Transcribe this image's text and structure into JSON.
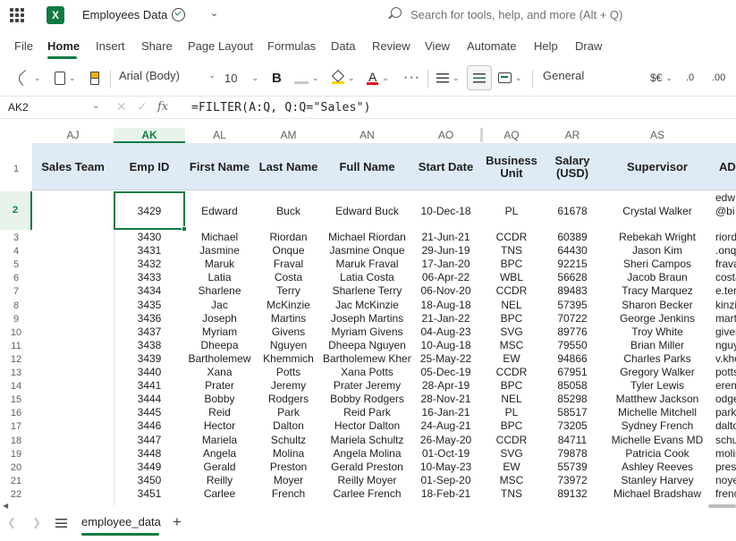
{
  "app": {
    "title": "Employees Data",
    "search_placeholder": "Search for tools, help, and more (Alt + Q)"
  },
  "ribbon": {
    "tabs": [
      "File",
      "Home",
      "Insert",
      "Share",
      "Page Layout",
      "Formulas",
      "Data",
      "Review",
      "View",
      "Automate",
      "Help",
      "Draw"
    ],
    "active_tab": "Home",
    "font_name": "Arial (Body)",
    "font_size": "10",
    "bold_label": "B",
    "font_color_label": "A",
    "number_format": "General",
    "currency_label": "$€",
    "increase_decimal_label": ".0",
    "decrease_decimal_label": ".00"
  },
  "formula_bar": {
    "name_box": "AK2",
    "fx_label": "fx",
    "formula": "=FILTER(A:Q, Q:Q=\"Sales\")"
  },
  "grid": {
    "column_headers": [
      "AJ",
      "AK",
      "AL",
      "AM",
      "AN",
      "AO",
      "AQ",
      "AR",
      "AS"
    ],
    "active_column": "AK",
    "row_numbers": [
      "1",
      "2",
      "3",
      "4",
      "5",
      "6",
      "7",
      "8",
      "9",
      "10",
      "11",
      "12",
      "13",
      "14",
      "15",
      "16",
      "17",
      "18",
      "19",
      "20",
      "21",
      "22"
    ],
    "header_labels": [
      "Sales Team",
      "Emp ID",
      "First Name",
      "Last Name",
      "Full Name",
      "Start Date",
      "Business Unit",
      "Salary (USD)",
      "Supervisor",
      "AD"
    ],
    "selected_row": {
      "emp_id": "3429",
      "first": "Edward",
      "last": "Buck",
      "full": "Edward Buck",
      "start": "10-Dec-18",
      "bu": "PL",
      "salary": "61678",
      "supervisor": "Crystal Walker",
      "partial_top": "edw",
      "partial_bottom": "@bi"
    },
    "rows": [
      [
        "3430",
        "Michael",
        "Riordan",
        "Michael Riordan",
        "21-Jun-21",
        "CCDR",
        "60389",
        "Rebekah Wright",
        "riord"
      ],
      [
        "3431",
        "Jasmine",
        "Onque",
        "Jasmine Onque",
        "29-Jun-19",
        "TNS",
        "64430",
        "Jason Kim",
        ".onqu"
      ],
      [
        "3432",
        "Maruk",
        "Fraval",
        "Maruk Fraval",
        "17-Jan-20",
        "BPC",
        "92215",
        "Sheri Campos",
        "frava"
      ],
      [
        "3433",
        "Latia",
        "Costa",
        "Latia Costa",
        "06-Apr-22",
        "WBL",
        "56628",
        "Jacob Braun",
        "costa"
      ],
      [
        "3434",
        "Sharlene",
        "Terry",
        "Sharlene Terry",
        "06-Nov-20",
        "CCDR",
        "89483",
        "Tracy Marquez",
        "e.ter"
      ],
      [
        "3435",
        "Jac",
        "McKinzie",
        "Jac McKinzie",
        "18-Aug-18",
        "NEL",
        "57395",
        "Sharon Becker",
        "kinzi"
      ],
      [
        "3436",
        "Joseph",
        "Martins",
        "Joseph Martins",
        "21-Jan-22",
        "BPC",
        "70722",
        "George Jenkins",
        "marti"
      ],
      [
        "3437",
        "Myriam",
        "Givens",
        "Myriam Givens",
        "04-Aug-23",
        "SVG",
        "89776",
        "Troy White",
        "giver"
      ],
      [
        "3438",
        "Dheepa",
        "Nguyen",
        "Dheepa Nguyen",
        "10-Aug-18",
        "MSC",
        "79550",
        "Brian Miller",
        "nguy"
      ],
      [
        "3439",
        "Bartholemew",
        "Khemmich",
        "Bartholemew Khemmich",
        "25-May-22",
        "EW",
        "94866",
        "Charles Parks",
        "v.khe"
      ],
      [
        "3440",
        "Xana",
        "Potts",
        "Xana Potts",
        "05-Dec-19",
        "CCDR",
        "67951",
        "Gregory Walker",
        "potts"
      ],
      [
        "3441",
        "Prater",
        "Jeremy",
        "Prater Jeremy",
        "28-Apr-19",
        "BPC",
        "85058",
        "Tyler Lewis",
        "erem"
      ],
      [
        "3444",
        "Bobby",
        "Rodgers",
        "Bobby Rodgers",
        "28-Nov-21",
        "NEL",
        "85298",
        "Matthew Jackson",
        "odge"
      ],
      [
        "3445",
        "Reid",
        "Park",
        "Reid Park",
        "16-Jan-21",
        "PL",
        "58517",
        "Michelle Mitchell",
        "park@"
      ],
      [
        "3446",
        "Hector",
        "Dalton",
        "Hector Dalton",
        "24-Aug-21",
        "BPC",
        "73205",
        "Sydney French",
        "dalto"
      ],
      [
        "3447",
        "Mariela",
        "Schultz",
        "Mariela Schultz",
        "26-May-20",
        "CCDR",
        "84711",
        "Michelle Evans MD",
        "schu"
      ],
      [
        "3448",
        "Angela",
        "Molina",
        "Angela Molina",
        "01-Oct-19",
        "SVG",
        "79878",
        "Patricia Cook",
        "molir"
      ],
      [
        "3449",
        "Gerald",
        "Preston",
        "Gerald Preston",
        "10-May-23",
        "EW",
        "55739",
        "Ashley Reeves",
        "presto"
      ],
      [
        "3450",
        "Reilly",
        "Moyer",
        "Reilly Moyer",
        "01-Sep-20",
        "MSC",
        "73972",
        "Stanley Harvey",
        "noye"
      ],
      [
        "3451",
        "Carlee",
        "French",
        "Carlee French",
        "18-Feb-21",
        "TNS",
        "89132",
        "Michael Bradshaw",
        "frenc"
      ]
    ]
  },
  "sheets": {
    "active": "employee_data",
    "add_label": "+"
  },
  "colors": {
    "accent": "#107c41",
    "header_fill": "#deeaf6"
  }
}
